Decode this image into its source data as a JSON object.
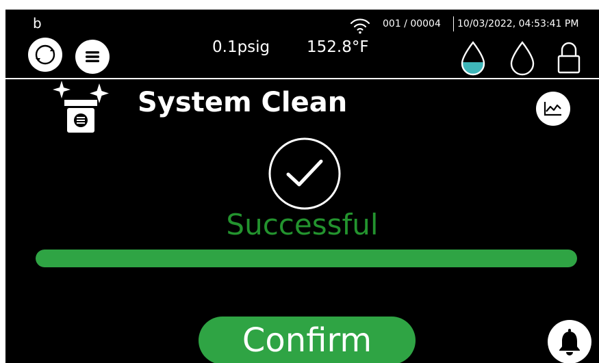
{
  "header": {
    "letter": "b",
    "counter": "001 / 00004",
    "datetime": "10/03/2022, 04:53:41 PM",
    "pressure": "0.1psig",
    "temperature": "152.8°F",
    "icons": [
      "refresh-icon",
      "menu-icon",
      "wifi-icon",
      "water-drop-filled-icon",
      "water-drop-empty-icon",
      "lock-icon"
    ]
  },
  "main": {
    "title": "System Clean",
    "title_icon": "system-clean-icon",
    "chart_icon": "chart-icon",
    "status_icon": "checkmark-icon",
    "status": "Successful",
    "progress": 1.0,
    "confirm_label": "Confirm",
    "alarm_icon": "bell-icon"
  },
  "colors": {
    "background": "#000000",
    "accent_green": "#2fa444",
    "status_green": "#23932e",
    "drop_fill": "#3fb6b9",
    "foreground": "#ffffff"
  }
}
